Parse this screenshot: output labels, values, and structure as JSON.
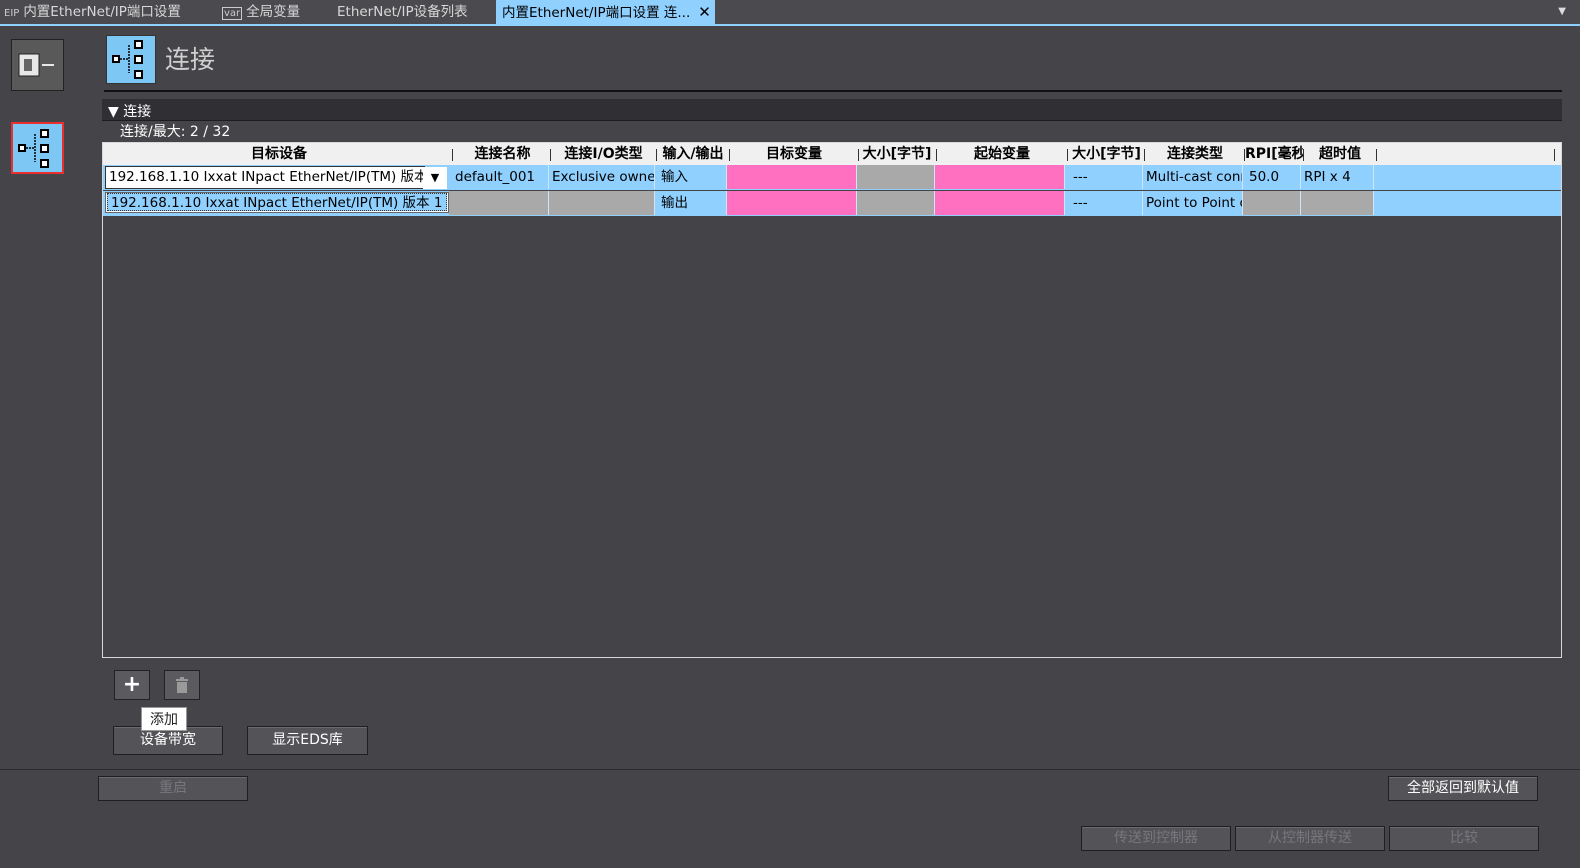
{
  "tabs": [
    {
      "label": "内置EtherNet/IP端口设置",
      "icon": "EIP"
    },
    {
      "label": "全局变量",
      "icon": "var"
    },
    {
      "label": "EtherNet/IP设备列表"
    },
    {
      "label": "内置EtherNet/IP端口设置 连...",
      "active": true
    }
  ],
  "header": {
    "title": "连接"
  },
  "section": {
    "title": "▼ 连接",
    "count_label": "连接/最大: 2 / 32"
  },
  "table": {
    "columns": [
      "目标设备",
      "连接名称",
      "连接I/O类型",
      "输入/输出",
      "目标变量",
      "大小[字节]",
      "起始变量",
      "大小[字节]",
      "连接类型",
      "RPI[毫秒]",
      "超时值"
    ],
    "rows": [
      {
        "target_device": "192.168.1.10 Ixxat INpact EtherNet/IP(TM) 版本 1",
        "name": "default_001",
        "io_type": "Exclusive owner",
        "io": "输入",
        "target_var": "",
        "size1": "",
        "start_var": "",
        "size2": "---",
        "conn_type": "Multi-cast connection",
        "rpi": "50.0",
        "timeout": "RPI x 4"
      },
      {
        "target_device": "",
        "name": "",
        "io_type": "",
        "io": "输出",
        "target_var": "",
        "size1": "",
        "start_var": "",
        "size2": "---",
        "conn_type": "Point to Point connection",
        "rpi": "",
        "timeout": ""
      }
    ],
    "dropdown_option": "192.168.1.10 Ixxat INpact EtherNet/IP(TM) 版本 1"
  },
  "tooltip": "添加",
  "buttons": {
    "device_bandwidth": "设备带宽",
    "show_eds": "显示EDS库",
    "restart": "重启",
    "reset_all": "全部返回到默认值",
    "transfer_to": "传送到控制器",
    "transfer_from": "从控制器传送",
    "compare": "比较"
  },
  "colors": {
    "accent": "#8fd0ff",
    "pink": "#ff70c0",
    "gray_cell": "#a9a9a9",
    "background": "#444449"
  }
}
